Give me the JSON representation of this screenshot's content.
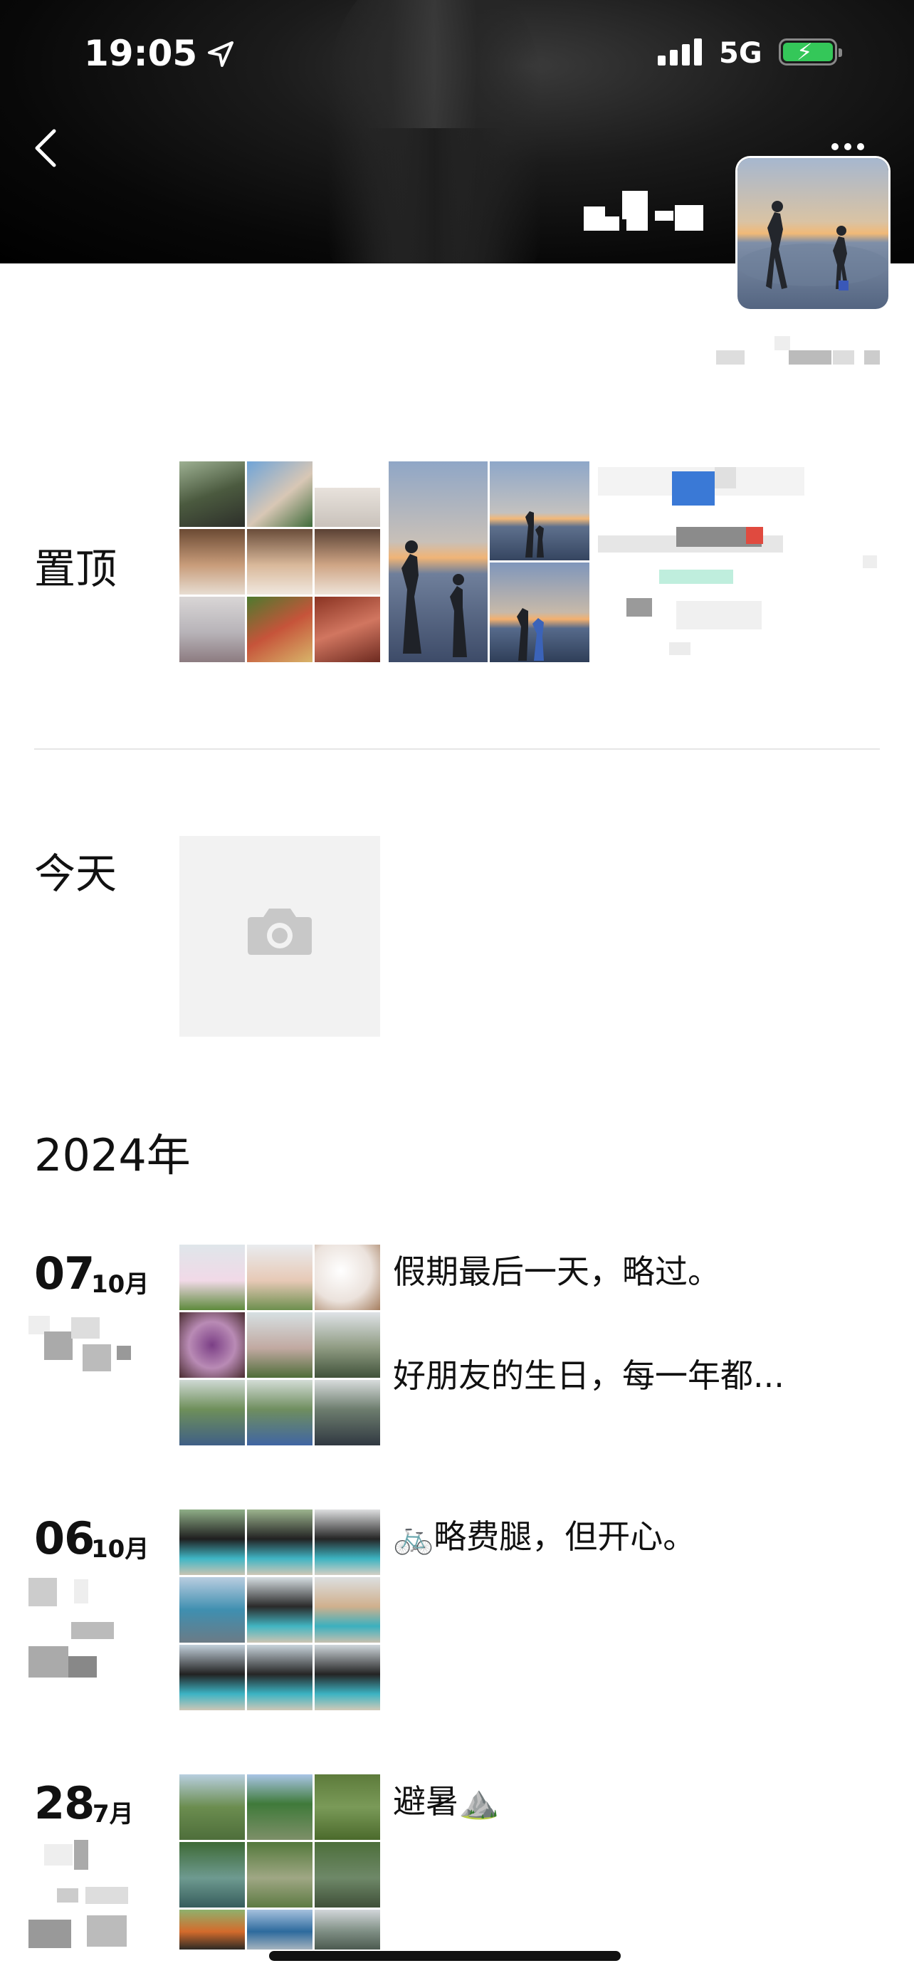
{
  "status_bar": {
    "time": "19:05",
    "network": "5G"
  },
  "header": {
    "back_icon": "chevron-left-icon",
    "more_icon": "ellipsis-icon"
  },
  "sections": {
    "pinned": {
      "label": "置顶"
    },
    "today": {
      "label": "今天",
      "camera_icon": "camera-icon"
    },
    "year": {
      "label": "2024年"
    }
  },
  "posts": [
    {
      "day": "07",
      "month": "10月",
      "texts": [
        "假期最后一天，略过。",
        "好朋友的生日，每一年都..."
      ]
    },
    {
      "day": "06",
      "month": "10月",
      "texts": [
        "🚲略费腿，但开心。"
      ]
    },
    {
      "day": "28",
      "month": "7月",
      "texts": [
        "避暑⛰️"
      ]
    }
  ],
  "colors": {
    "battery": "#34c759",
    "cover": "#000000",
    "divider": "#e6e6e6",
    "placeholder": "#f2f2f2"
  }
}
